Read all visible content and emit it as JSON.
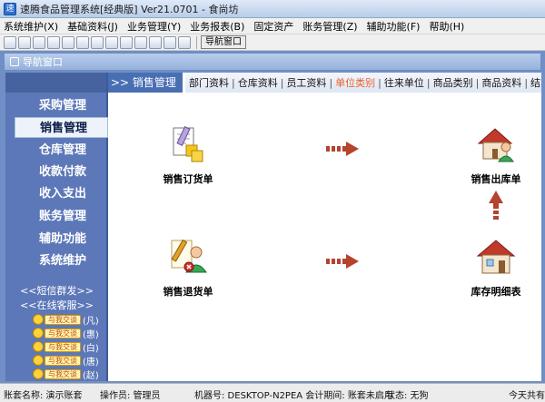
{
  "app": {
    "title": "速腾食品管理系统[经典版] Ver21.0701  -  食尚坊"
  },
  "menu": {
    "items": [
      "系统维护(X)",
      "基础资料(J)",
      "业务管理(Y)",
      "业务报表(B)",
      "固定资产",
      "账务管理(Z)",
      "辅助功能(F)",
      "帮助(H)"
    ]
  },
  "toolbar": {
    "nav_window_button": "导航窗口"
  },
  "subwindow": {
    "title": "导航窗口"
  },
  "leftnav": {
    "items": [
      "采购管理",
      "销售管理",
      "仓库管理",
      "收款付款",
      "收入支出",
      "账务管理",
      "辅助功能",
      "系统维护"
    ],
    "active_index": 1,
    "sms_link": "<<短信群发>>",
    "service_link": "<<在线客服>>",
    "service_badge": "与我交谈",
    "service_agents": [
      "(凡)",
      "(惠)",
      "(白)",
      "(唐)",
      "(赵)"
    ]
  },
  "section": {
    "title": ">> 销售管理",
    "quick_links": [
      "部门资料",
      "仓库资料",
      "员工资料",
      "单位类别",
      "往来单位",
      "商品类别",
      "商品资料",
      "结算方式"
    ],
    "highlight_index": 3
  },
  "functions": {
    "sales_order": "销售订货单",
    "sales_outbound": "销售出库单",
    "sales_return": "销售退货单",
    "inventory_detail": "库存明细表"
  },
  "colors": {
    "accent_blue": "#496fb3",
    "arrow": "#c0392b"
  },
  "statusbar": {
    "account": "账套名称: 演示账套",
    "operator": "操作员: 管理员",
    "machine": "机器号: DESKTOP-N2PEA 会计期间: 账套未启用",
    "state": "状态: 无狗",
    "today": "今天共有"
  }
}
